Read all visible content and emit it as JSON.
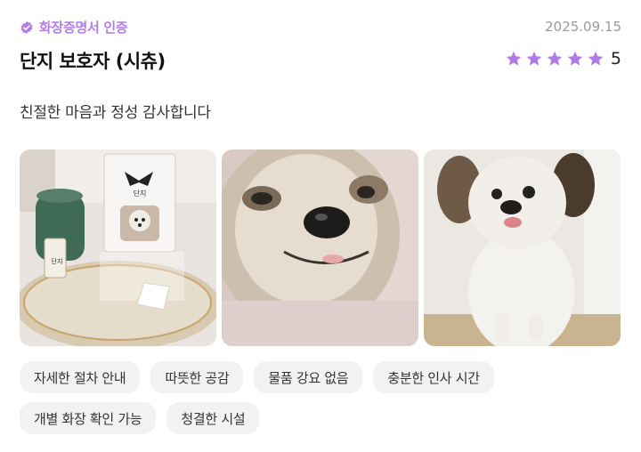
{
  "review": {
    "badge_label": "화장증명서 인증",
    "date": "2025.09.15",
    "title": "단지 보호자 (시츄)",
    "rating": 5,
    "rating_label": "5",
    "text": "친절한 마음과 정성 감사합니다",
    "memorial_name": "단지",
    "memorial_tag": "단지"
  },
  "photos": [
    {
      "name": "photo-memorial-altar",
      "icon": "memorial-photo"
    },
    {
      "name": "photo-dog-closeup",
      "icon": "dog-photo"
    },
    {
      "name": "photo-dog-standing",
      "icon": "dog-photo"
    }
  ],
  "tags": [
    "자세한 절차 안내",
    "따뜻한 공감",
    "물품 강요 없음",
    "충분한 인사 시간",
    "개별 화장 확인 가능",
    "청결한 시설"
  ],
  "colors": {
    "accent": "#b57be8",
    "star": "#b07ae8",
    "tag_bg": "#f2f2f2"
  }
}
